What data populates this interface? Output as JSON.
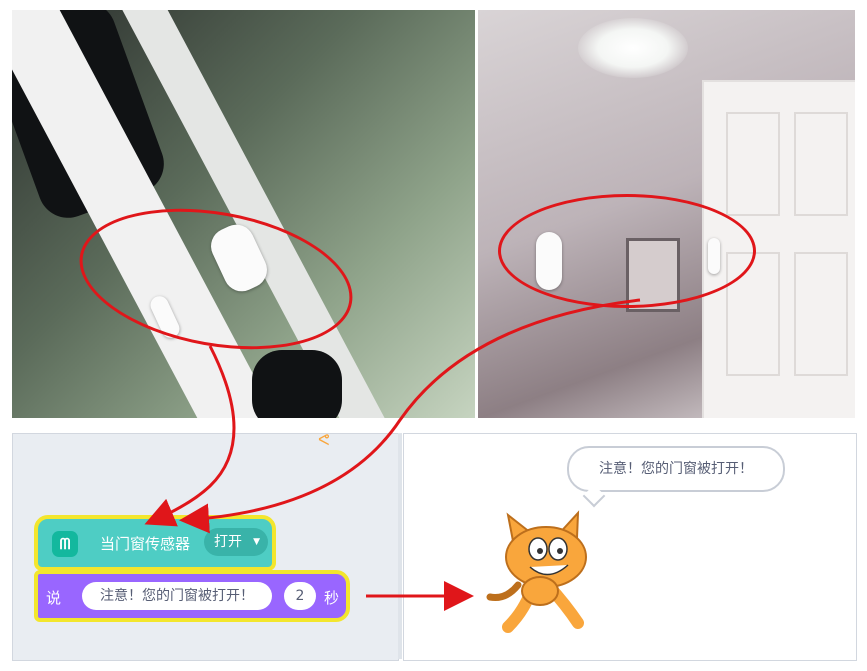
{
  "hat_block": {
    "icon": "mi-icon",
    "label": "当门窗传感器",
    "dropdown_value": "打开"
  },
  "say_block": {
    "label": "说",
    "message": "注意！您的门窗被打开！",
    "seconds": "2",
    "seconds_unit": "秒"
  },
  "stage": {
    "speech_bubble": "注意！您的门窗被打开！"
  },
  "colors": {
    "annotation": "#e0161a",
    "highlight": "#f3e62d",
    "hat_block": "#4ecdc4",
    "looks_block": "#9966ff"
  }
}
